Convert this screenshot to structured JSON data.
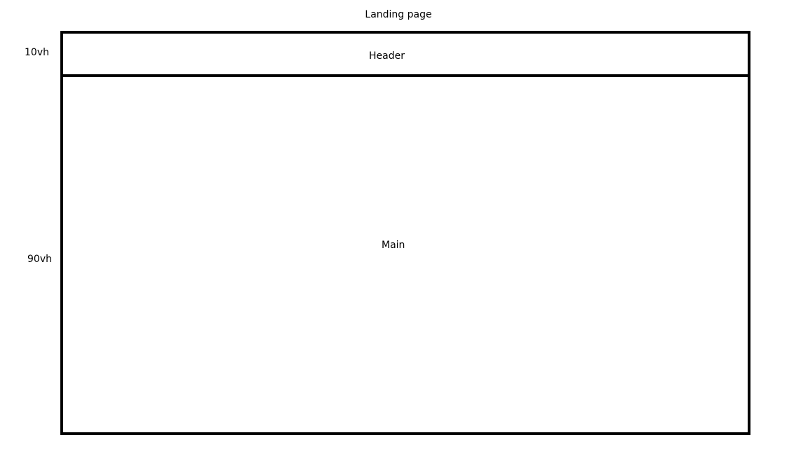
{
  "title": "Landing page",
  "dimension_labels": {
    "header": "10vh",
    "main": "90vh"
  },
  "sections": {
    "header": "Header",
    "main": "Main"
  }
}
